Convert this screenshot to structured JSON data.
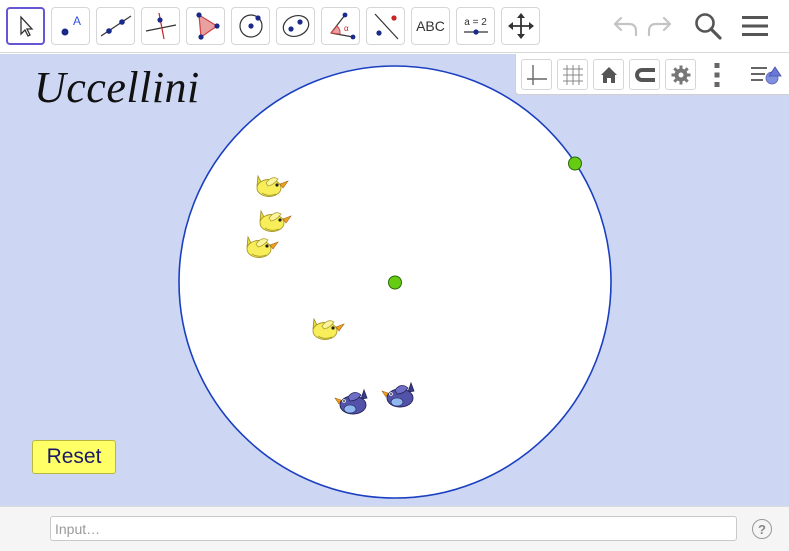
{
  "toolbar": {
    "tools": [
      {
        "name": "move-tool",
        "label": ""
      },
      {
        "name": "point-tool",
        "label": ""
      },
      {
        "name": "line-tool",
        "label": ""
      },
      {
        "name": "perpendicular-line-tool",
        "label": ""
      },
      {
        "name": "polygon-tool",
        "label": ""
      },
      {
        "name": "circle-center-point-tool",
        "label": ""
      },
      {
        "name": "ellipse-tool",
        "label": ""
      },
      {
        "name": "angle-tool",
        "label": ""
      },
      {
        "name": "reflect-tool",
        "label": ""
      },
      {
        "name": "text-tool",
        "label": "ABC"
      },
      {
        "name": "slider-tool",
        "label": "a = 2"
      },
      {
        "name": "move-graphics-view-tool",
        "label": ""
      }
    ],
    "selected_tool": "move-tool",
    "accent_color": "#6557d2"
  },
  "graphics": {
    "title": "Uccellini",
    "background_color": "#cdd7f4",
    "circle_color": "#1a3fbf",
    "point_color": "#66cc11",
    "yellow_bird_color": "#f7ee5a",
    "blue_bird_color": "#4a4aa0"
  },
  "reset_button": {
    "label": "Reset",
    "color": "#ffff66"
  },
  "input_bar": {
    "placeholder": "Input…",
    "help_label": "?"
  }
}
